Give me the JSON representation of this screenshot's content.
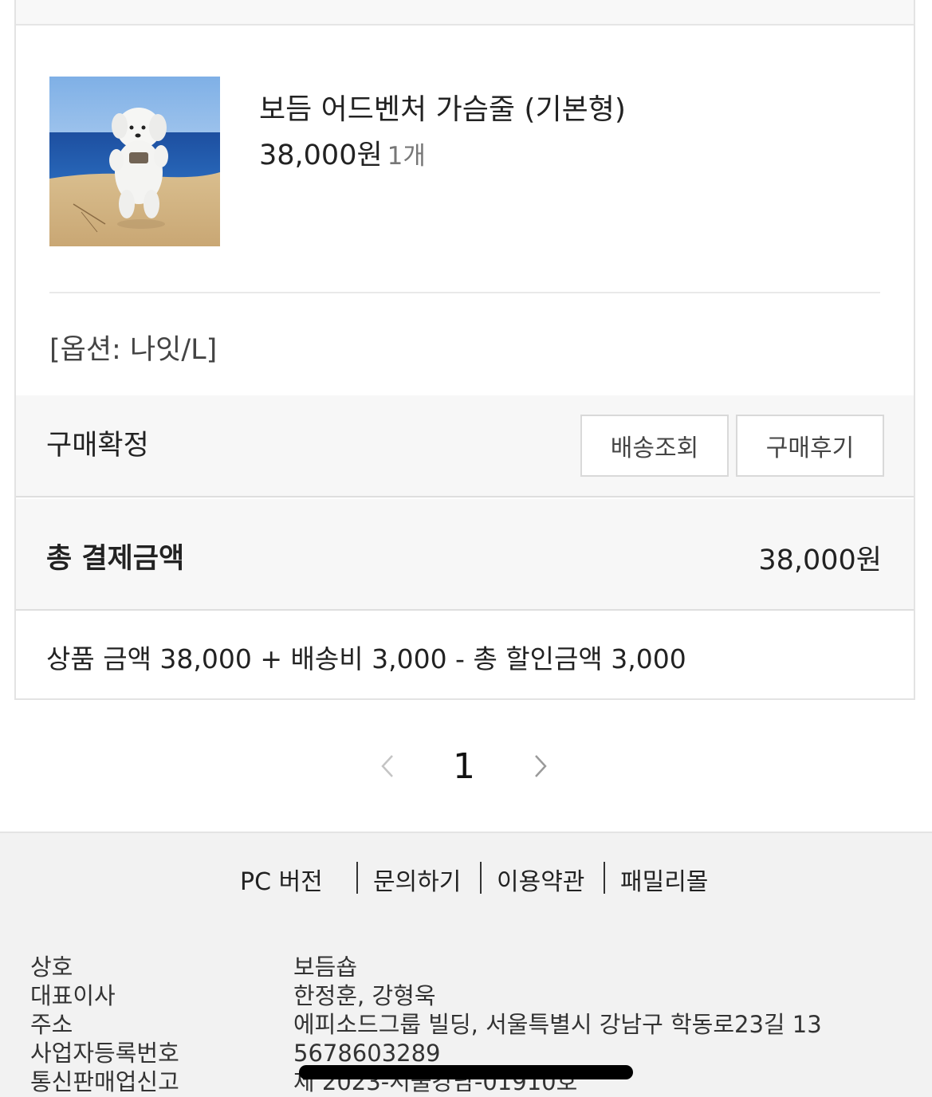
{
  "order": {
    "product_name": "보듬 어드벤처 가슴줄 (기본형)",
    "price": "38,000원",
    "quantity": "1개",
    "option": "[옵션: 나잇/L]",
    "thumbnail_alt": "product photo: white dog running on beach"
  },
  "status": {
    "label": "구매확정",
    "track_button": "배송조회",
    "review_button": "구매후기"
  },
  "total": {
    "label": "총 결제금액",
    "value": "38,000원",
    "breakdown": "상품 금액 38,000 + 배송비 3,000 - 총 할인금액 3,000"
  },
  "pagination": {
    "prev_icon": "chevron-left-icon",
    "current": "1",
    "next_icon": "chevron-right-icon"
  },
  "footer": {
    "links": [
      "PC 버전",
      "문의하기",
      "이용약관",
      "패밀리몰"
    ],
    "info": [
      {
        "key": "상호",
        "value": "보듬숍"
      },
      {
        "key": "대표이사",
        "value": "한정훈, 강형욱"
      },
      {
        "key": "주소",
        "value": "에피소드그룹 빌딩, 서울특별시 강남구 학동로23길 13"
      },
      {
        "key": "사업자등록번호",
        "value": "5678603289"
      },
      {
        "key": "통신판매업신고",
        "value": "제 2023-서울강남-01910호"
      }
    ]
  },
  "colors": {
    "card_border": "#e3e3e3",
    "row_background": "#f7f7f7",
    "footer_background": "#f2f2f2",
    "text_primary": "#222222",
    "text_secondary": "#777777"
  }
}
